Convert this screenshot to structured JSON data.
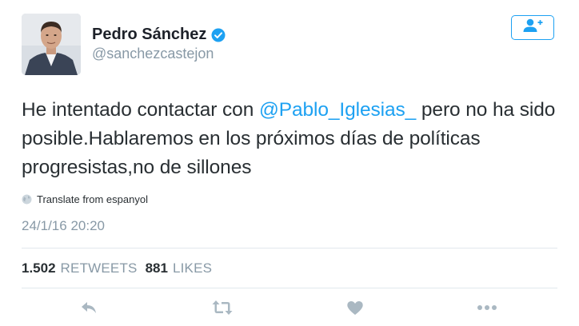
{
  "author": {
    "name": "Pedro Sánchez",
    "handle": "@sanchezcastejon",
    "verified": true
  },
  "tweet": {
    "text_before": "He intentado contactar con ",
    "mention": "@Pablo_Iglesias_",
    "text_after": " pero no ha sido posible.Hablaremos en los próximos días de políticas progresistas,no de sillones"
  },
  "translate_label": "Translate from espanyol",
  "timestamp": "24/1/16 20:20",
  "stats": {
    "retweets_count": "1.502",
    "retweets_label": "RETWEETS",
    "likes_count": "881",
    "likes_label": "LIKES"
  },
  "icons": {
    "follow": "follow-user-icon",
    "verified": "verified-badge-icon",
    "translate": "globe-icon",
    "reply": "reply-icon",
    "retweet": "retweet-icon",
    "like": "heart-icon",
    "more": "more-icon"
  },
  "colors": {
    "accent": "#1da1f2",
    "muted": "#8899a6",
    "text": "#292f33",
    "icon": "#aab8c2"
  }
}
